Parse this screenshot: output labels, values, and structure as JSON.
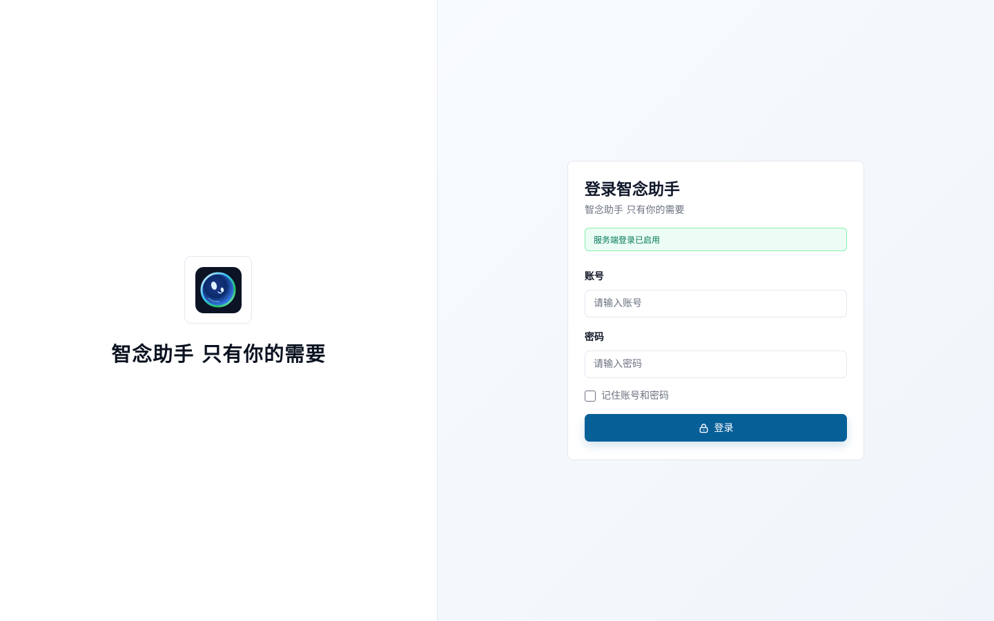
{
  "brand": {
    "logo_icon": "bubble-eye-logo-icon",
    "tagline": "智念助手 只有你的需要"
  },
  "login": {
    "title": "登录智念助手",
    "subtitle": "智念助手 只有你的需要",
    "status_message": "服务端登录已启用",
    "account": {
      "label": "账号",
      "placeholder": "请输入账号",
      "value": ""
    },
    "password": {
      "label": "密码",
      "placeholder": "请输入密码",
      "value": ""
    },
    "remember": {
      "label": "记住账号和密码",
      "checked": false
    },
    "submit": {
      "label": "登录",
      "icon": "lock-icon"
    }
  },
  "colors": {
    "primary": "#075f98",
    "success_bg": "#ecfdf5",
    "success_border": "#86efac",
    "success_text": "#047857"
  }
}
